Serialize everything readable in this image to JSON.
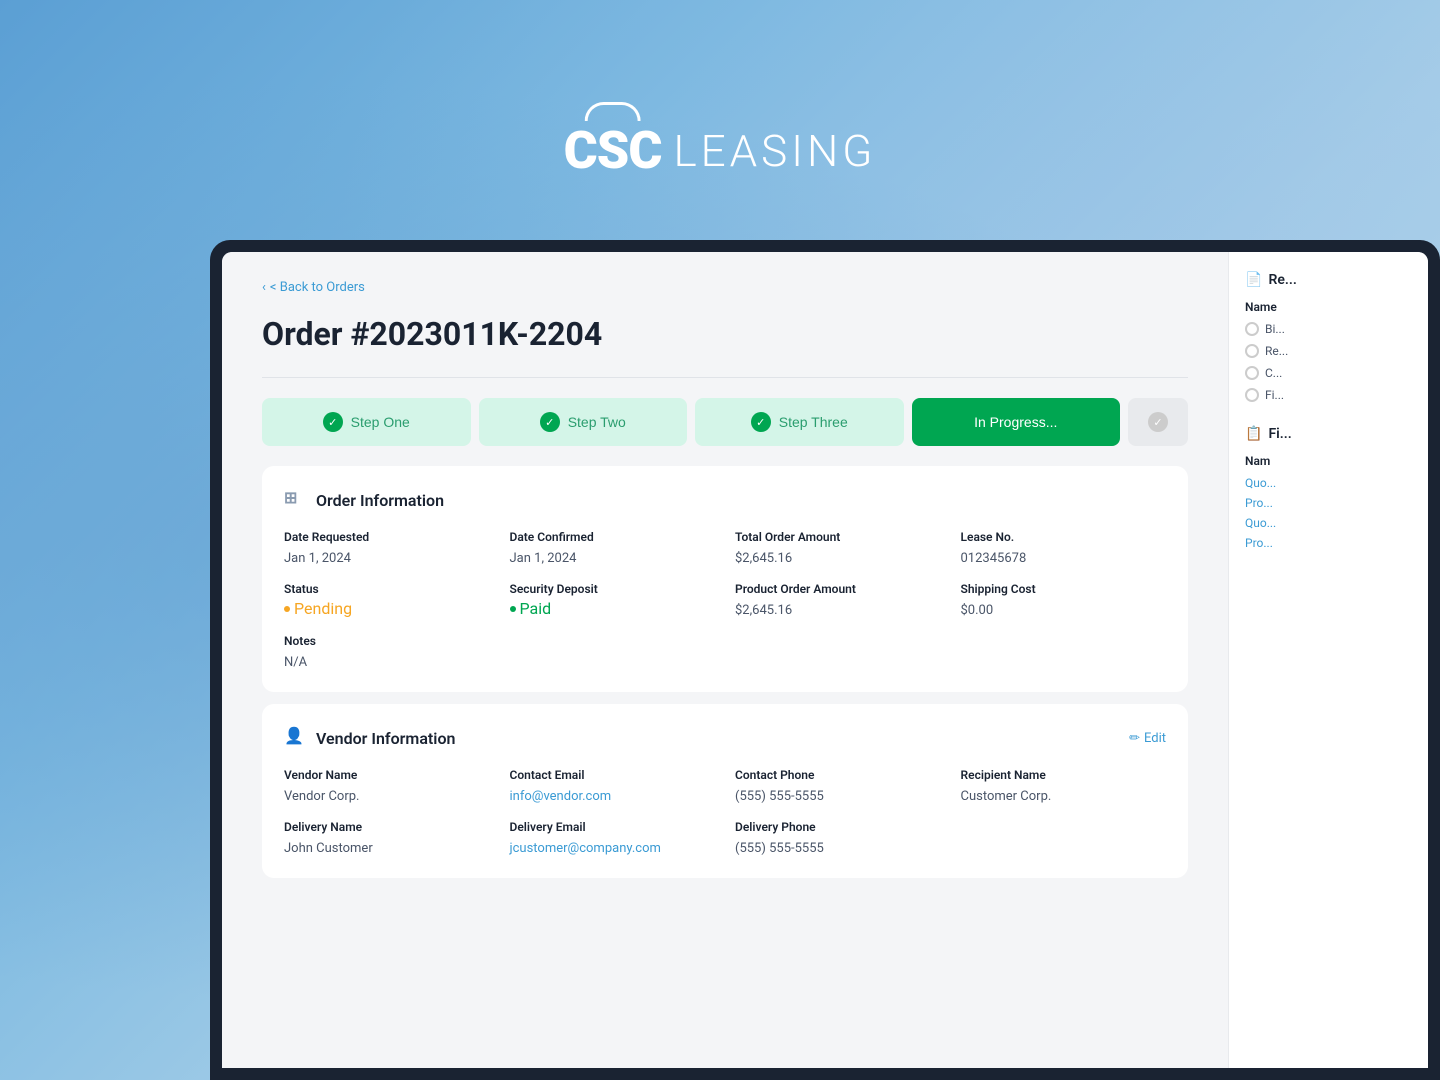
{
  "brand": {
    "csc_text": "CSC",
    "leasing_text": "LEASING"
  },
  "nav": {
    "back_label": "< Back to Orders"
  },
  "page": {
    "title": "Order #2023011K-2204"
  },
  "steps": [
    {
      "id": "step-one",
      "label": "Step One",
      "state": "completed"
    },
    {
      "id": "step-two",
      "label": "Step Two",
      "state": "completed"
    },
    {
      "id": "step-three",
      "label": "Step Three",
      "state": "completed"
    },
    {
      "id": "in-progress",
      "label": "In Progress...",
      "state": "active"
    },
    {
      "id": "final",
      "label": "",
      "state": "future"
    }
  ],
  "order_info": {
    "section_title": "Order Information",
    "fields": {
      "date_requested_label": "Date Requested",
      "date_requested_value": "Jan 1, 2024",
      "date_confirmed_label": "Date Confirmed",
      "date_confirmed_value": "Jan 1, 2024",
      "total_order_amount_label": "Total Order Amount",
      "total_order_amount_value": "$2,645.16",
      "lease_no_label": "Lease No.",
      "lease_no_value": "012345678",
      "status_label": "Status",
      "status_value": "Pending",
      "security_deposit_label": "Security Deposit",
      "security_deposit_value": "Paid",
      "product_order_amount_label": "Product Order Amount",
      "product_order_amount_value": "$2,645.16",
      "shipping_cost_label": "Shipping Cost",
      "shipping_cost_value": "$0.00",
      "notes_label": "Notes",
      "notes_value": "N/A"
    }
  },
  "vendor_info": {
    "section_title": "Vendor Information",
    "edit_label": "Edit",
    "fields": {
      "vendor_name_label": "Vendor Name",
      "vendor_name_value": "Vendor Corp.",
      "contact_email_label": "Contact Email",
      "contact_email_value": "info@vendor.com",
      "contact_phone_label": "Contact Phone",
      "contact_phone_value": "(555) 555-5555",
      "recipient_name_label": "Recipient Name",
      "recipient_name_value": "Customer Corp.",
      "delivery_name_label": "Delivery Name",
      "delivery_name_value": "John Customer",
      "delivery_email_label": "Delivery Email",
      "delivery_email_value": "jcustomer@company.com",
      "delivery_phone_label": "Delivery Phone",
      "delivery_phone_value": "(555) 555-5555"
    }
  },
  "right_panel": {
    "receipt_title": "Re...",
    "receipt_name_label": "Name",
    "receipt_options": [
      "Bi...",
      "Re...",
      "C...",
      "Fi..."
    ],
    "files_title": "Fi...",
    "files_name_label": "Nam",
    "file_links": [
      "Quo...",
      "Pro...",
      "Quo...",
      "Pro..."
    ]
  },
  "colors": {
    "completed_bg": "#d4f5e8",
    "completed_text": "#2a9d6e",
    "active_bg": "#00a651",
    "active_text": "#ffffff",
    "link_color": "#3b9bd4",
    "pending_color": "#f6a623",
    "paid_color": "#00a651"
  }
}
